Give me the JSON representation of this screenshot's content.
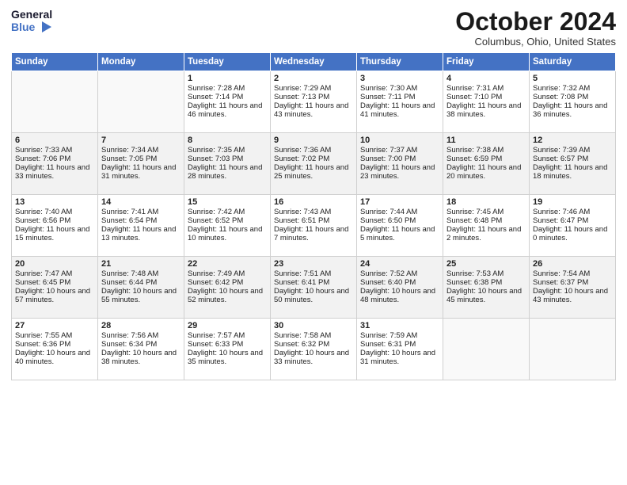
{
  "header": {
    "logo_line1": "General",
    "logo_line2": "Blue",
    "month": "October 2024",
    "location": "Columbus, Ohio, United States"
  },
  "days_of_week": [
    "Sunday",
    "Monday",
    "Tuesday",
    "Wednesday",
    "Thursday",
    "Friday",
    "Saturday"
  ],
  "weeks": [
    [
      {
        "day": "",
        "info": ""
      },
      {
        "day": "",
        "info": ""
      },
      {
        "day": "1",
        "info": "Sunrise: 7:28 AM\nSunset: 7:14 PM\nDaylight: 11 hours and 46 minutes."
      },
      {
        "day": "2",
        "info": "Sunrise: 7:29 AM\nSunset: 7:13 PM\nDaylight: 11 hours and 43 minutes."
      },
      {
        "day": "3",
        "info": "Sunrise: 7:30 AM\nSunset: 7:11 PM\nDaylight: 11 hours and 41 minutes."
      },
      {
        "day": "4",
        "info": "Sunrise: 7:31 AM\nSunset: 7:10 PM\nDaylight: 11 hours and 38 minutes."
      },
      {
        "day": "5",
        "info": "Sunrise: 7:32 AM\nSunset: 7:08 PM\nDaylight: 11 hours and 36 minutes."
      }
    ],
    [
      {
        "day": "6",
        "info": "Sunrise: 7:33 AM\nSunset: 7:06 PM\nDaylight: 11 hours and 33 minutes."
      },
      {
        "day": "7",
        "info": "Sunrise: 7:34 AM\nSunset: 7:05 PM\nDaylight: 11 hours and 31 minutes."
      },
      {
        "day": "8",
        "info": "Sunrise: 7:35 AM\nSunset: 7:03 PM\nDaylight: 11 hours and 28 minutes."
      },
      {
        "day": "9",
        "info": "Sunrise: 7:36 AM\nSunset: 7:02 PM\nDaylight: 11 hours and 25 minutes."
      },
      {
        "day": "10",
        "info": "Sunrise: 7:37 AM\nSunset: 7:00 PM\nDaylight: 11 hours and 23 minutes."
      },
      {
        "day": "11",
        "info": "Sunrise: 7:38 AM\nSunset: 6:59 PM\nDaylight: 11 hours and 20 minutes."
      },
      {
        "day": "12",
        "info": "Sunrise: 7:39 AM\nSunset: 6:57 PM\nDaylight: 11 hours and 18 minutes."
      }
    ],
    [
      {
        "day": "13",
        "info": "Sunrise: 7:40 AM\nSunset: 6:56 PM\nDaylight: 11 hours and 15 minutes."
      },
      {
        "day": "14",
        "info": "Sunrise: 7:41 AM\nSunset: 6:54 PM\nDaylight: 11 hours and 13 minutes."
      },
      {
        "day": "15",
        "info": "Sunrise: 7:42 AM\nSunset: 6:52 PM\nDaylight: 11 hours and 10 minutes."
      },
      {
        "day": "16",
        "info": "Sunrise: 7:43 AM\nSunset: 6:51 PM\nDaylight: 11 hours and 7 minutes."
      },
      {
        "day": "17",
        "info": "Sunrise: 7:44 AM\nSunset: 6:50 PM\nDaylight: 11 hours and 5 minutes."
      },
      {
        "day": "18",
        "info": "Sunrise: 7:45 AM\nSunset: 6:48 PM\nDaylight: 11 hours and 2 minutes."
      },
      {
        "day": "19",
        "info": "Sunrise: 7:46 AM\nSunset: 6:47 PM\nDaylight: 11 hours and 0 minutes."
      }
    ],
    [
      {
        "day": "20",
        "info": "Sunrise: 7:47 AM\nSunset: 6:45 PM\nDaylight: 10 hours and 57 minutes."
      },
      {
        "day": "21",
        "info": "Sunrise: 7:48 AM\nSunset: 6:44 PM\nDaylight: 10 hours and 55 minutes."
      },
      {
        "day": "22",
        "info": "Sunrise: 7:49 AM\nSunset: 6:42 PM\nDaylight: 10 hours and 52 minutes."
      },
      {
        "day": "23",
        "info": "Sunrise: 7:51 AM\nSunset: 6:41 PM\nDaylight: 10 hours and 50 minutes."
      },
      {
        "day": "24",
        "info": "Sunrise: 7:52 AM\nSunset: 6:40 PM\nDaylight: 10 hours and 48 minutes."
      },
      {
        "day": "25",
        "info": "Sunrise: 7:53 AM\nSunset: 6:38 PM\nDaylight: 10 hours and 45 minutes."
      },
      {
        "day": "26",
        "info": "Sunrise: 7:54 AM\nSunset: 6:37 PM\nDaylight: 10 hours and 43 minutes."
      }
    ],
    [
      {
        "day": "27",
        "info": "Sunrise: 7:55 AM\nSunset: 6:36 PM\nDaylight: 10 hours and 40 minutes."
      },
      {
        "day": "28",
        "info": "Sunrise: 7:56 AM\nSunset: 6:34 PM\nDaylight: 10 hours and 38 minutes."
      },
      {
        "day": "29",
        "info": "Sunrise: 7:57 AM\nSunset: 6:33 PM\nDaylight: 10 hours and 35 minutes."
      },
      {
        "day": "30",
        "info": "Sunrise: 7:58 AM\nSunset: 6:32 PM\nDaylight: 10 hours and 33 minutes."
      },
      {
        "day": "31",
        "info": "Sunrise: 7:59 AM\nSunset: 6:31 PM\nDaylight: 10 hours and 31 minutes."
      },
      {
        "day": "",
        "info": ""
      },
      {
        "day": "",
        "info": ""
      }
    ]
  ]
}
